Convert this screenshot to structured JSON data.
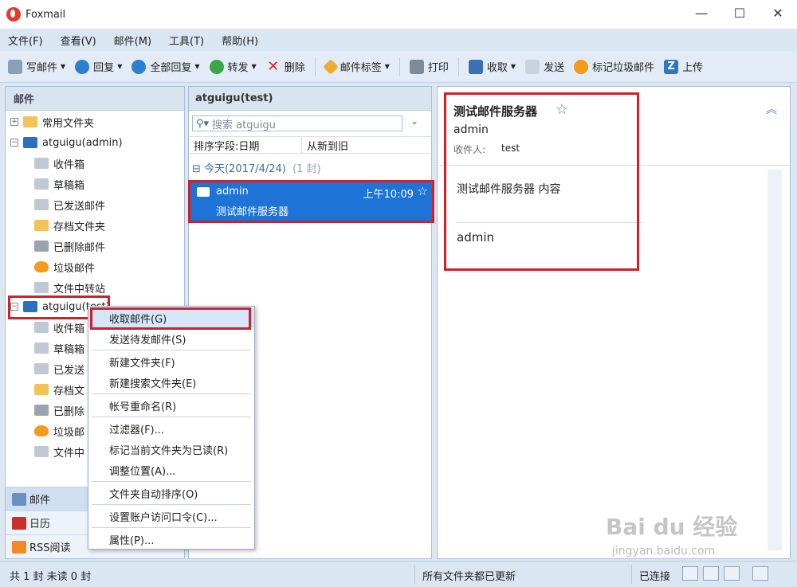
{
  "window": {
    "title": "Foxmail",
    "minimize": "—",
    "maximize": "☐",
    "close": "✕"
  },
  "menubar": [
    "文件(F)",
    "查看(V)",
    "邮件(M)",
    "工具(T)",
    "帮助(H)"
  ],
  "toolbar": {
    "compose": "写邮件",
    "reply": "回复",
    "reply_all": "全部回复",
    "forward": "转发",
    "delete": "删除",
    "tags": "邮件标签",
    "print": "打印",
    "receive": "收取",
    "send": "发送",
    "spam": "标记垃圾邮件",
    "upload": "上传"
  },
  "left": {
    "header": "邮件",
    "common_folder": "常用文件夹",
    "account1": "atguigu(admin)",
    "account1_folders": [
      "收件箱",
      "草稿箱",
      "已发送邮件",
      "存档文件夹",
      "已删除邮件",
      "垃圾邮件",
      "文件中转站"
    ],
    "account2": "atguigu(test)",
    "account2_folders": [
      "收件箱",
      "草稿箱",
      "已发送",
      "存档文",
      "已删除",
      "垃圾邮",
      "文件中"
    ],
    "nav": [
      "邮件",
      "日历",
      "RSS阅读"
    ]
  },
  "middle": {
    "header": "atguigu(test)",
    "search_placeholder": "搜索 atguigu",
    "sort_field": "排序字段:日期",
    "sort_order": "从新到旧",
    "group_label": "今天(2017/4/24)",
    "group_count": "(1 封)",
    "message": {
      "from": "admin",
      "time": "上午10:09",
      "subject": "测试邮件服务器"
    }
  },
  "reader": {
    "subject": "测试邮件服务器",
    "sender": "admin",
    "to_label": "收件人:",
    "to_value": "test",
    "body": "测试邮件服务器  内容",
    "signature": "admin"
  },
  "context_menu": [
    "收取邮件(G)",
    "发送待发邮件(S)",
    "新建文件夹(F)",
    "新建搜索文件夹(E)",
    "帐号重命名(R)",
    "过滤器(F)...",
    "标记当前文件夹为已读(R)",
    "调整位置(A)...",
    "文件夹自动排序(O)",
    "设置账户访问口令(C)...",
    "属性(P)..."
  ],
  "status": {
    "left": "共 1 封 未读 0 封",
    "middle": "所有文件夹都已更新",
    "connection": "已连接"
  },
  "watermark": {
    "logo": "Bai du 经验",
    "url": "jingyan.baidu.com"
  },
  "colors": {
    "selection": "#1e73d6",
    "highlight": "#d0202a",
    "panel_bg": "#dde7f2"
  }
}
